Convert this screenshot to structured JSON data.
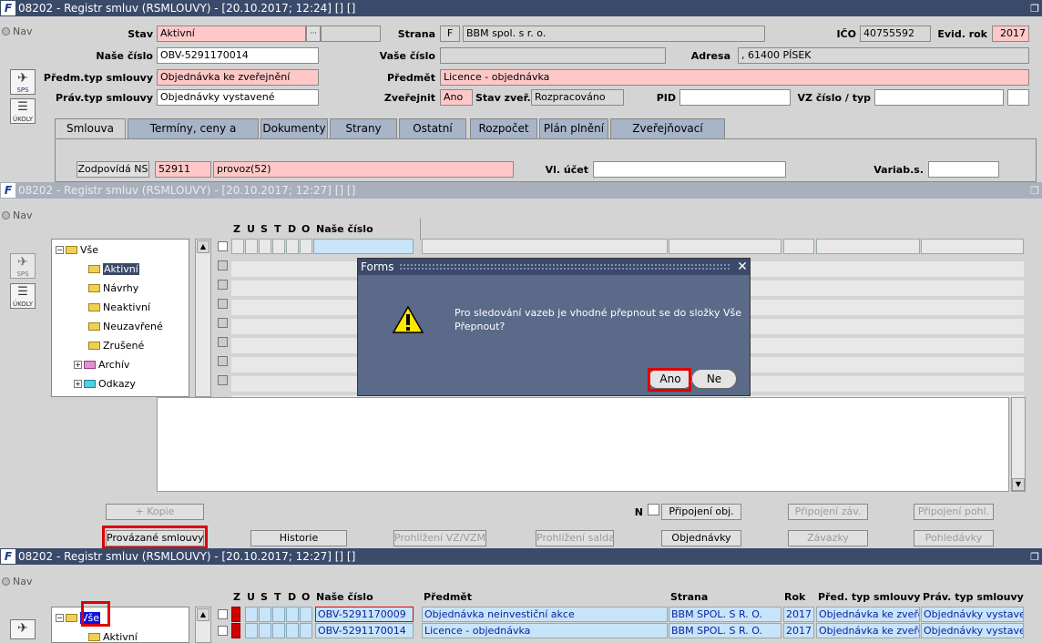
{
  "window1": {
    "title": "08202 - Registr smluv (RSMLOUVY) - [20.10.2017; 12:24] [] []",
    "nav": "Nav",
    "side_sps": "SPS",
    "side_ukoly": "ÚKOLY",
    "labels": {
      "stav": "Stav",
      "nase_cislo": "Naše číslo",
      "predm_typ": "Předm.typ smlouvy",
      "prav_typ": "Práv.typ smlouvy",
      "strana": "Strana",
      "vase_cislo": "Vaše číslo",
      "predmet": "Předmět",
      "zverejnit": "Zveřejnit",
      "stav_zver": "Stav zveř.",
      "pid": "PID",
      "ico": "IČO",
      "evid_rok": "Evid. rok",
      "adresa": "Adresa",
      "vz_cislo": "VZ číslo / typ",
      "vl_ucet": "Vl. účet",
      "variab": "Variab.s."
    },
    "values": {
      "stav": "Aktivní",
      "nase_cislo": "OBV-5291170014",
      "predm_typ": "Objednávka ke zveřejnění",
      "prav_typ": "Objednávky vystavené",
      "strana_code": "F",
      "strana_name": "BBM spol. s r. o.",
      "vase_cislo": "",
      "predmet": "Licence - objednávka",
      "zverejnit": "Ano",
      "stav_zver": "Rozpracováno",
      "pid": "",
      "ico": "40755592",
      "evid_rok": "2017",
      "adresa": ", 61400 PÍSEK",
      "zodpovida_code": "52911",
      "zodpovida_name": "provoz(52)"
    },
    "ellipsis": "···",
    "tabs": [
      "Smlouva",
      "Termíny, ceny a činnosti",
      "Dokumenty",
      "Strany",
      "Ostatní",
      "Rozpočet",
      "Plán plnění",
      "Zveřejňovací doložka"
    ],
    "zodpovida_btn": "Zodpovídá NS"
  },
  "window2": {
    "title": "08202 - Registr smluv (RSMLOUVY) - [20.10.2017; 12:27] [] []",
    "nav": "Nav",
    "side_sps": "SPS",
    "side_ukoly": "ÚKOLY",
    "col_flags": [
      "Z",
      "U",
      "S",
      "T",
      "D",
      "O"
    ],
    "col_nase": "Naše číslo",
    "tree": [
      {
        "label": "Vše",
        "icon": "folder-open"
      },
      {
        "label": "Aktivní",
        "icon": "folder"
      },
      {
        "label": "Návrhy",
        "icon": "folder"
      },
      {
        "label": "Neaktivní",
        "icon": "folder"
      },
      {
        "label": "Neuzavřené",
        "icon": "folder"
      },
      {
        "label": "Zrušené",
        "icon": "folder"
      },
      {
        "label": "Archív",
        "icon": "folder-pink"
      },
      {
        "label": "Odkazy",
        "icon": "folder-cyan"
      }
    ],
    "n_label": "N",
    "buttons_row1": {
      "kopie": "+ Kopie",
      "pripojeni_obj": "Připojení obj.",
      "pripojeni_zav": "Připojení záv.",
      "pripojeni_pohl": "Připojení pohl."
    },
    "buttons_row2": {
      "provazane": "Provázané smlouvy",
      "historie": "Historie",
      "prohlizeni_vz": "Prohlížení VZ/VZM",
      "prohlizeni_salda": "Prohlížení salda",
      "objednavky": "Objednávky",
      "zavazky": "Závazky",
      "pohledavky": "Pohledávky"
    }
  },
  "dialog": {
    "title": "Forms",
    "message_line1": "Pro sledování vazeb je vhodné přepnout se do složky Vše",
    "message_line2": "Přepnout?",
    "yes": "Ano",
    "no": "Ne",
    "close": "✕"
  },
  "window3": {
    "title": "08202 - Registr smluv (RSMLOUVY) - [20.10.2017; 12:27] [] []",
    "nav": "Nav",
    "col_flags": [
      "Z",
      "U",
      "S",
      "T",
      "D",
      "O"
    ],
    "columns": {
      "nase": "Naše číslo",
      "predmet": "Předmět",
      "strana": "Strana",
      "rok": "Rok",
      "pred_typ": "Před. typ smlouvy",
      "prav_typ": "Práv. typ smlouvy"
    },
    "tree": [
      {
        "label": "Vše"
      },
      {
        "label": "Aktivní"
      }
    ],
    "rows": [
      {
        "nase": "OBV-5291170009",
        "predmet": "Objednávka neinvestiční akce",
        "strana": "BBM SPOL. S R. O.",
        "rok": "2017",
        "pred_typ": "Objednávka ke zveřejn",
        "prav_typ": "Objednávky vystavené"
      },
      {
        "nase": "OBV-5291170014",
        "predmet": "Licence - objednávka",
        "strana": "BBM SPOL. S R. O.",
        "rok": "2017",
        "pred_typ": "Objednávka ke zveřejn",
        "prav_typ": "Objednávky vystavené"
      }
    ]
  }
}
